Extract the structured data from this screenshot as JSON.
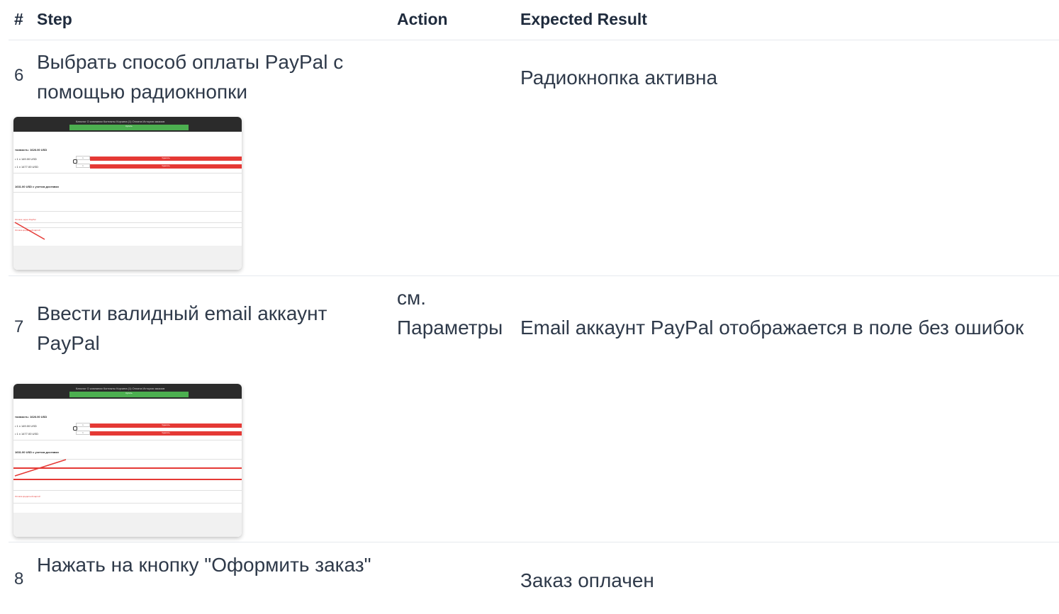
{
  "columns": {
    "num": "#",
    "step": "Step",
    "action": "Action",
    "expected": "Expected Result"
  },
  "rows": [
    {
      "num": "6",
      "step": "Выбрать способ оплаты PayPal с помощью радиокнопки",
      "action": "",
      "expected": "Радиокнопка активна"
    },
    {
      "num": "7",
      "step": "Ввести валидный email аккаунт PayPal",
      "action": "см. Параметры",
      "expected": "Email аккаунт PayPal отображается в поле без ошибок"
    },
    {
      "num": "8",
      "step": "Нажать на кнопку \"Оформить заказ\"",
      "action": "",
      "expected": "Заказ оплачен"
    }
  ],
  "thumbnail": {
    "nav": "Каталог    О компании    Контакты    Корзина (1)    Оплата    История заказов",
    "button": "Купить",
    "total": "тоимость: 1626.00 USD",
    "item1": "• 1 x 149.00 USD",
    "item2": "• 1 x 1477.00 USD",
    "qty": "1",
    "remove": "Удалить",
    "delivery_total": "1631.00 USD с учетом доставки",
    "paypal_option": "Оплата через PayPal",
    "card_option": "Оплата кредитной картой"
  },
  "colors": {
    "text": "#2f3a4a",
    "divider": "#e6e9ee",
    "accent_red": "#e53935",
    "accent_green": "#4caf50"
  }
}
